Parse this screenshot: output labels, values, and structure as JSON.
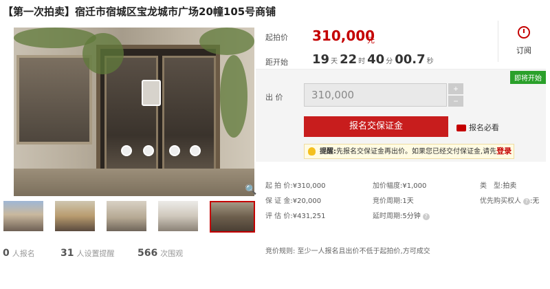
{
  "title": "【第一次拍卖】宿迁市宿城区宝龙城市广场20幢105号商铺",
  "price_box": {
    "start_price_label": "起拍价",
    "start_price": "310,000",
    "currency": "元",
    "countdown_label": "距开始",
    "days": "19",
    "days_unit": "天",
    "hours": "22",
    "hours_unit": "时",
    "minutes": "40",
    "minutes_unit": "分",
    "seconds": "00.7",
    "seconds_unit": "秒",
    "subscribe_label": "订阅"
  },
  "bid": {
    "status_badge": "即将开始",
    "bid_label": "出 价",
    "bid_value": "310,000",
    "plus": "+",
    "minus": "−",
    "signup_button": "报名交保证金",
    "must_read": "报名必看",
    "tip_prefix": "提醒:",
    "tip_text": "先报名交保证金再出价。如果您已经交付保证金,请先",
    "tip_login": "登录"
  },
  "details": {
    "start_price": {
      "k": "起 拍 价:",
      "v": "¥310,000"
    },
    "deposit": {
      "k": "保 证 金:",
      "v": "¥20,000"
    },
    "appraisal": {
      "k": "评 估 价:",
      "v": "¥431,251"
    },
    "increment": {
      "k": "加价幅度:",
      "v": "¥1,000"
    },
    "cycle": {
      "k": "竞价周期:",
      "v": "1天"
    },
    "extension": {
      "k": "延时周期:",
      "v": "5分钟"
    },
    "type": {
      "k": "类　型:",
      "v": "拍卖"
    },
    "priority": {
      "k": "优先购买权人",
      "v": "无"
    },
    "rule": "竞价规则:   至少一人报名且出价不低于起拍价,方可成交"
  },
  "stats": [
    {
      "num": "0",
      "label": "人报名"
    },
    {
      "num": "31",
      "label": "人设置提醒"
    },
    {
      "num": "566",
      "label": "次围观"
    }
  ],
  "colors": {
    "accent": "#c40000",
    "button": "#c81d1d",
    "badge": "#2aa02a"
  },
  "icons": [
    "clock-icon",
    "coin-icon",
    "bulb-icon",
    "zoom-icon",
    "question-icon"
  ]
}
